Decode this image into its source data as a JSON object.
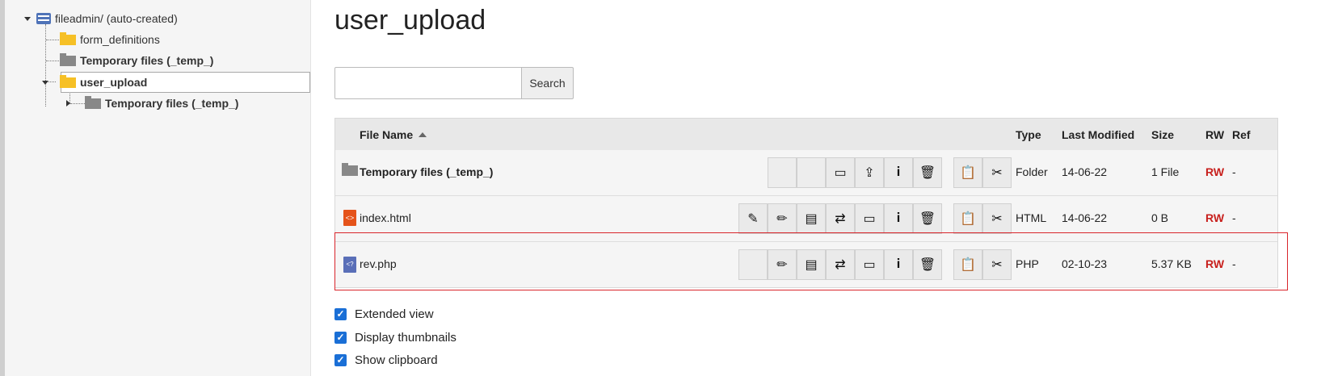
{
  "tree": {
    "root": "fileadmin/ (auto-created)",
    "items": [
      {
        "label": "form_definitions"
      },
      {
        "label": "Temporary files (_temp_)"
      },
      {
        "label": "user_upload"
      },
      {
        "label": "Temporary files (_temp_)"
      }
    ]
  },
  "main": {
    "title": "user_upload",
    "search": {
      "button": "Search",
      "value": ""
    },
    "table": {
      "headers": {
        "name": "File Name",
        "type": "Type",
        "modified": "Last Modified",
        "size": "Size",
        "rw": "RW",
        "ref": "Ref"
      },
      "rows": [
        {
          "name": "Temporary files (_temp_)",
          "type": "Folder",
          "modified": "14-06-22",
          "size": "1 File",
          "rw": "RW",
          "ref": "-"
        },
        {
          "name": "index.html",
          "type": "HTML",
          "modified": "14-06-22",
          "size": "0 B",
          "rw": "RW",
          "ref": "-"
        },
        {
          "name": "rev.php",
          "type": "PHP",
          "modified": "02-10-23",
          "size": "5.37 KB",
          "rw": "RW",
          "ref": "-"
        }
      ]
    },
    "options": [
      {
        "label": "Extended view",
        "checked": true
      },
      {
        "label": "Display thumbnails",
        "checked": true
      },
      {
        "label": "Show clipboard",
        "checked": true
      }
    ]
  },
  "colors": {
    "accent": "#1a6fd6",
    "rw": "#c8211e",
    "highlight": "#d9252b",
    "folder": "#f6c026"
  }
}
